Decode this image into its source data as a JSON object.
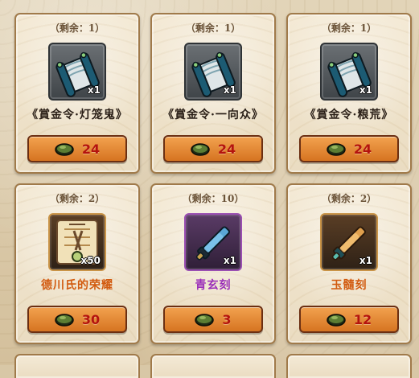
{
  "shop": {
    "items": [
      {
        "remaining": "（剩余：1）",
        "name": "《賞金令·灯笼鬼》",
        "count": "x1",
        "price": "24",
        "icon": "scroll-icon",
        "rarity": "normal"
      },
      {
        "remaining": "（剩余：1）",
        "name": "《賞金令·一向众》",
        "count": "x1",
        "price": "24",
        "icon": "scroll-icon",
        "rarity": "normal"
      },
      {
        "remaining": "（剩余：1）",
        "name": "《賞金令·粮荒》",
        "count": "x1",
        "price": "24",
        "icon": "scroll-icon",
        "rarity": "normal"
      },
      {
        "remaining": "（剩余：2）",
        "name": "德川氏的荣耀",
        "count": "x50",
        "price": "30",
        "icon": "banner-icon",
        "rarity": "gold"
      },
      {
        "remaining": "（剩余：10）",
        "name": "青玄刻",
        "count": "x1",
        "price": "3",
        "icon": "blade-icon",
        "rarity": "purple"
      },
      {
        "remaining": "（剩余：2）",
        "name": "玉髓刻",
        "count": "x1",
        "price": "12",
        "icon": "blade-icon",
        "rarity": "gold"
      }
    ]
  },
  "colors": {
    "price_text": "#b4130e",
    "button": "#e48a34",
    "card_bg": "#efe3cc"
  }
}
